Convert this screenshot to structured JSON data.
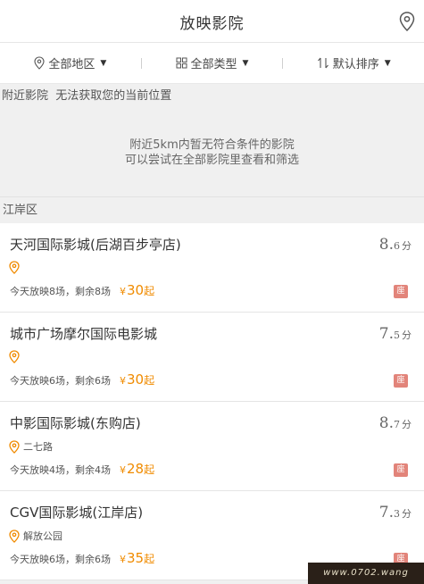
{
  "header": {
    "title": "放映影院",
    "location_icon": "map-pin-icon"
  },
  "filters": [
    {
      "label": "全部地区",
      "icon": "map-pin-icon"
    },
    {
      "label": "全部类型",
      "icon": "grid-icon"
    },
    {
      "label": "默认排序",
      "icon": "sort-icon"
    }
  ],
  "nearby": {
    "label": "附近影院",
    "status": "无法获取您的当前位置"
  },
  "empty_state": {
    "line1": "附近5km内暂无符合条件的影院",
    "line2": "可以尝试在全部影院里查看和筛选"
  },
  "district": {
    "name": "江岸区"
  },
  "cinemas": [
    {
      "name": "天河国际影城(后湖百步亭店)",
      "score_int": "8.",
      "score_dec": "6",
      "score_unit": "分",
      "address": "",
      "shows": "今天放映8场，剩余8场",
      "currency": "¥",
      "price": "30",
      "price_suffix": "起",
      "badge": "座"
    },
    {
      "name": "城市广场摩尔国际电影城",
      "score_int": "7.",
      "score_dec": "5",
      "score_unit": "分",
      "address": "",
      "shows": "今天放映6场，剩余6场",
      "currency": "¥",
      "price": "30",
      "price_suffix": "起",
      "badge": "座"
    },
    {
      "name": "中影国际影城(东购店)",
      "score_int": "8.",
      "score_dec": "7",
      "score_unit": "分",
      "address": "二七路",
      "shows": "今天放映4场，剩余4场",
      "currency": "¥",
      "price": "28",
      "price_suffix": "起",
      "badge": "座"
    },
    {
      "name": "CGV国际影城(江岸店)",
      "score_int": "7.",
      "score_dec": "3",
      "score_unit": "分",
      "address": "解放公园",
      "shows": "今天放映6场，剩余6场",
      "currency": "¥",
      "price": "35",
      "price_suffix": "起",
      "badge": "座"
    }
  ],
  "watermark": {
    "text": "www.0702.wang"
  },
  "colors": {
    "accent": "#f08b00",
    "badge": "#e2847a",
    "background": "#f0f0f0",
    "filter_bar": "#ffffff"
  }
}
